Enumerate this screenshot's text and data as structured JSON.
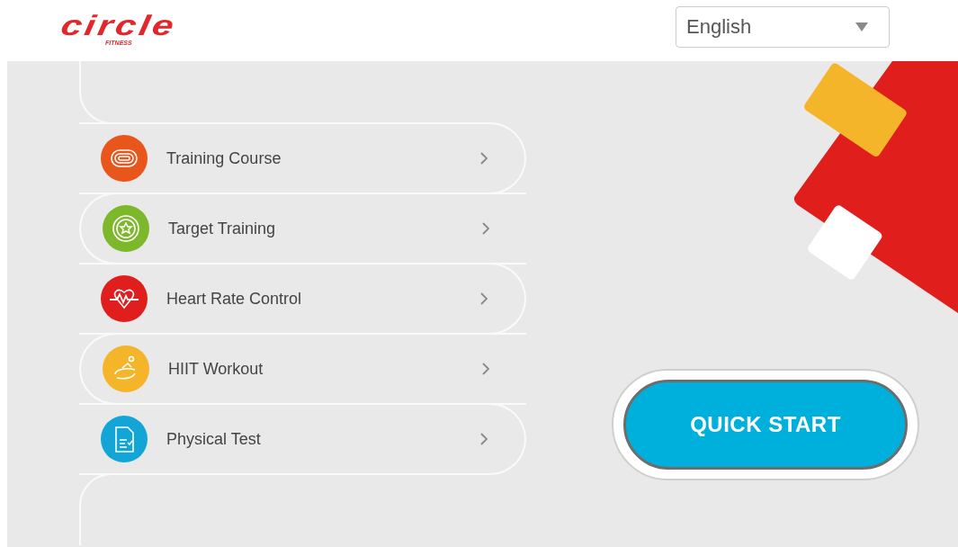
{
  "logo": {
    "name": "circle",
    "tagline": "FITNESS"
  },
  "language_select": {
    "value": "English"
  },
  "menu": [
    {
      "label": "Training Course",
      "color": "#e8561c"
    },
    {
      "label": "Target Training",
      "color": "#7cb82a"
    },
    {
      "label": "Heart Rate Control",
      "color": "#e01e1e"
    },
    {
      "label": "HIIT Workout",
      "color": "#f5b52a"
    },
    {
      "label": "Physical Test",
      "color": "#12a5d6"
    }
  ],
  "quick_start": {
    "label": "QUICK START"
  }
}
